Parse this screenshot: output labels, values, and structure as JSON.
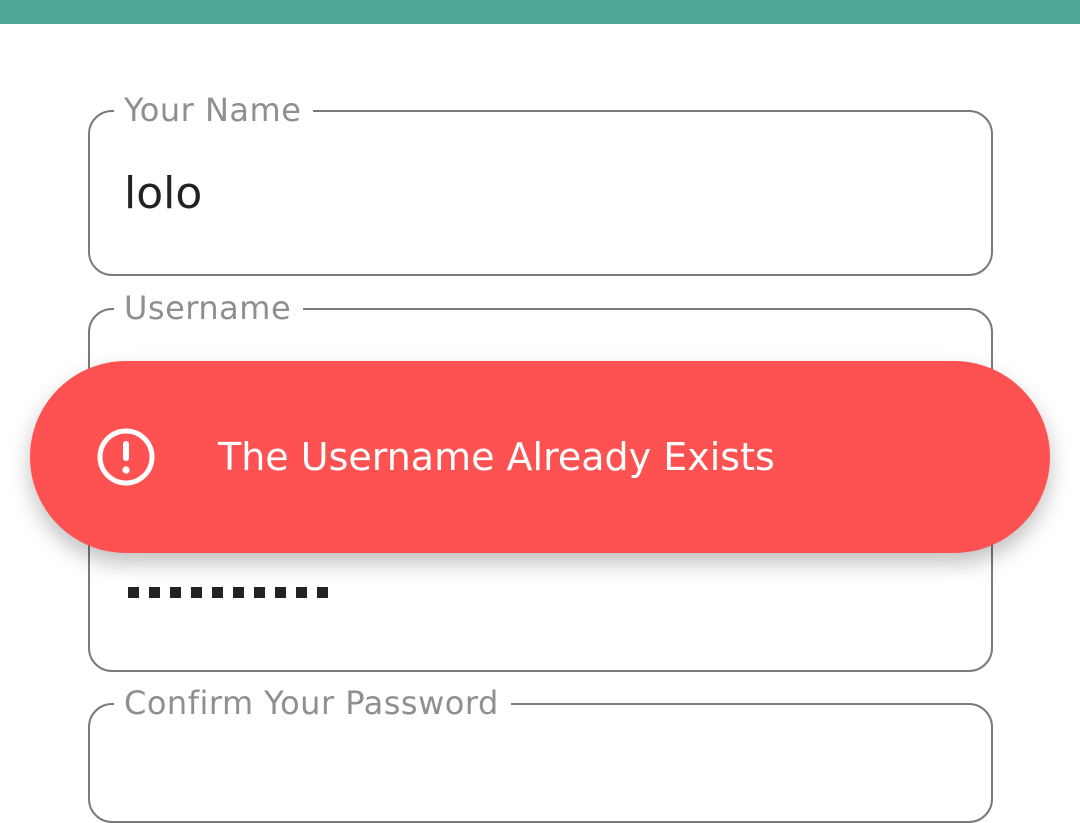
{
  "app_bar": {
    "color": "#4fa896"
  },
  "form": {
    "name_field": {
      "label": "Your Name",
      "value": "lolo"
    },
    "username_field": {
      "label": "Username"
    },
    "password_field": {
      "masked_length": 10
    },
    "confirm_field": {
      "label": "Confirm Your Password"
    }
  },
  "toast": {
    "icon": "exclamation-circle-icon",
    "message": "The Username Already Exists",
    "background": "#fe5252"
  }
}
